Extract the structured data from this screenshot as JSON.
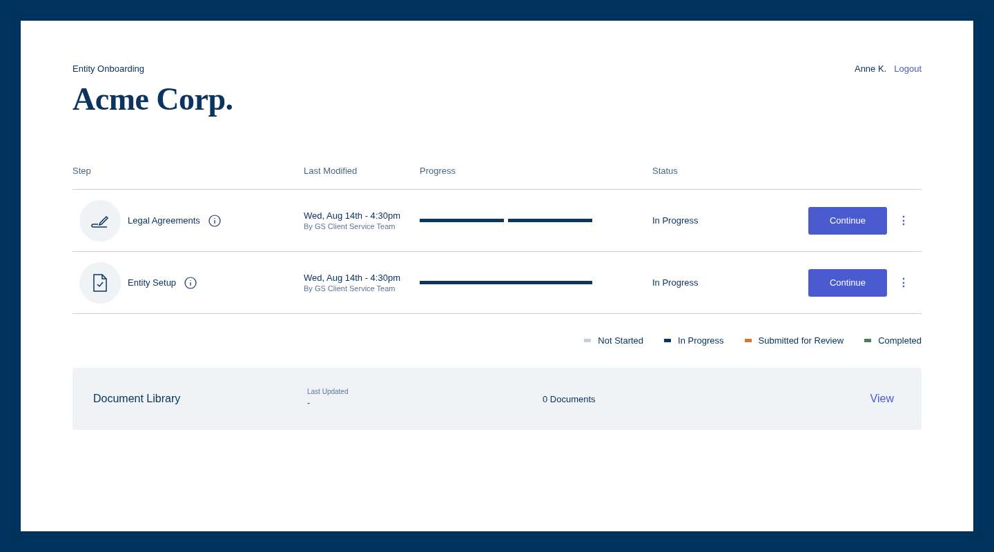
{
  "header": {
    "eyebrow": "Entity Onboarding",
    "title": "Acme Corp.",
    "user": "Anne K.",
    "logout": "Logout"
  },
  "table": {
    "columns": [
      "Step",
      "Last Modified",
      "Progress",
      "Status"
    ],
    "rows": [
      {
        "kind": "signature",
        "step": "Legal Agreements",
        "modified": "Wed, Aug 14th - 4:30pm",
        "by": "By GS Client Service Team",
        "segments": [
          {
            "color": "#0c3460"
          },
          {
            "color": "#0c3460"
          }
        ],
        "status": "In Progress",
        "action": "Continue",
        "menu": "⋮"
      },
      {
        "kind": "form",
        "step": "Entity Setup",
        "modified": "Wed, Aug 14th - 4:30pm",
        "by": "By GS Client Service Team",
        "segments": [
          {
            "color": "#0c3460"
          }
        ],
        "status": "In Progress",
        "action": "Continue",
        "menu": "⋮"
      }
    ]
  },
  "legend": [
    {
      "label": "Not Started",
      "color": "#c5d0da"
    },
    {
      "label": "In Progress",
      "color": "#0c3460"
    },
    {
      "label": "Submitted for Review",
      "color": "#de7433"
    },
    {
      "label": "Completed",
      "color": "#4e7c63"
    }
  ],
  "library": {
    "title": "Document Library",
    "updated_label": "Last Updated",
    "updated_value": "-",
    "count": "0 Documents",
    "link": "View"
  }
}
